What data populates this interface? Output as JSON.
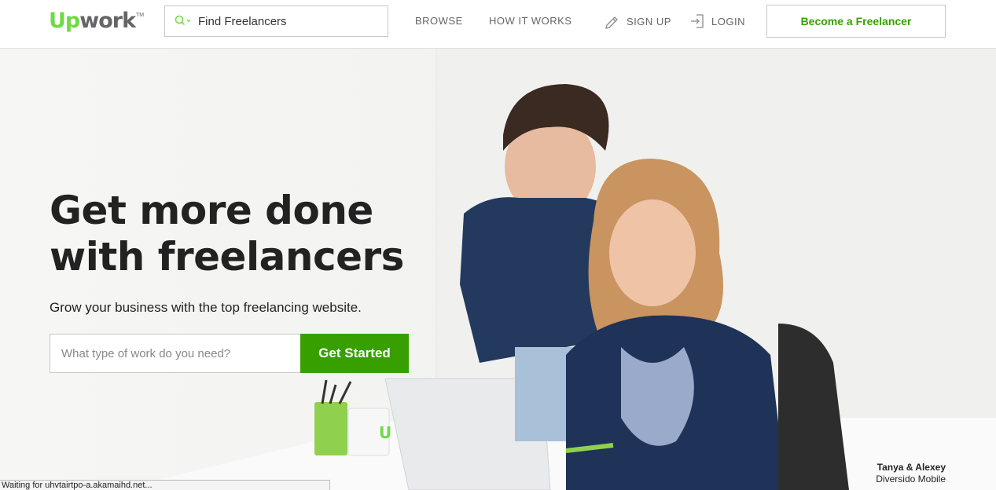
{
  "header": {
    "logo": {
      "up": "Up",
      "work": "work",
      "tm": "TM"
    },
    "search": {
      "placeholder": "Find Freelancers",
      "value": "Find Freelancers"
    },
    "nav": {
      "browse": "BROWSE",
      "how_it_works": "HOW IT WORKS",
      "sign_up": "SIGN UP",
      "login": "LOGIN"
    },
    "become_freelancer": "Become a Freelancer"
  },
  "hero": {
    "headline_line1": "Get more done",
    "headline_line2": "with freelancers",
    "subhead": "Grow your business with the top freelancing website.",
    "input_placeholder": "What type of work do you need?",
    "cta": "Get Started",
    "caption_name": "Tanya & Alexey",
    "caption_company": "Diversido Mobile"
  },
  "status_bar": "Waiting for uhvtairtpo-a.akamaihd.net...",
  "colors": {
    "brand_green": "#6fda44",
    "cta_green": "#37a000",
    "text_dark": "#222222",
    "nav_gray": "#656565"
  },
  "icons": [
    "search-icon",
    "chevron-down-icon",
    "pencil-icon",
    "login-icon"
  ]
}
